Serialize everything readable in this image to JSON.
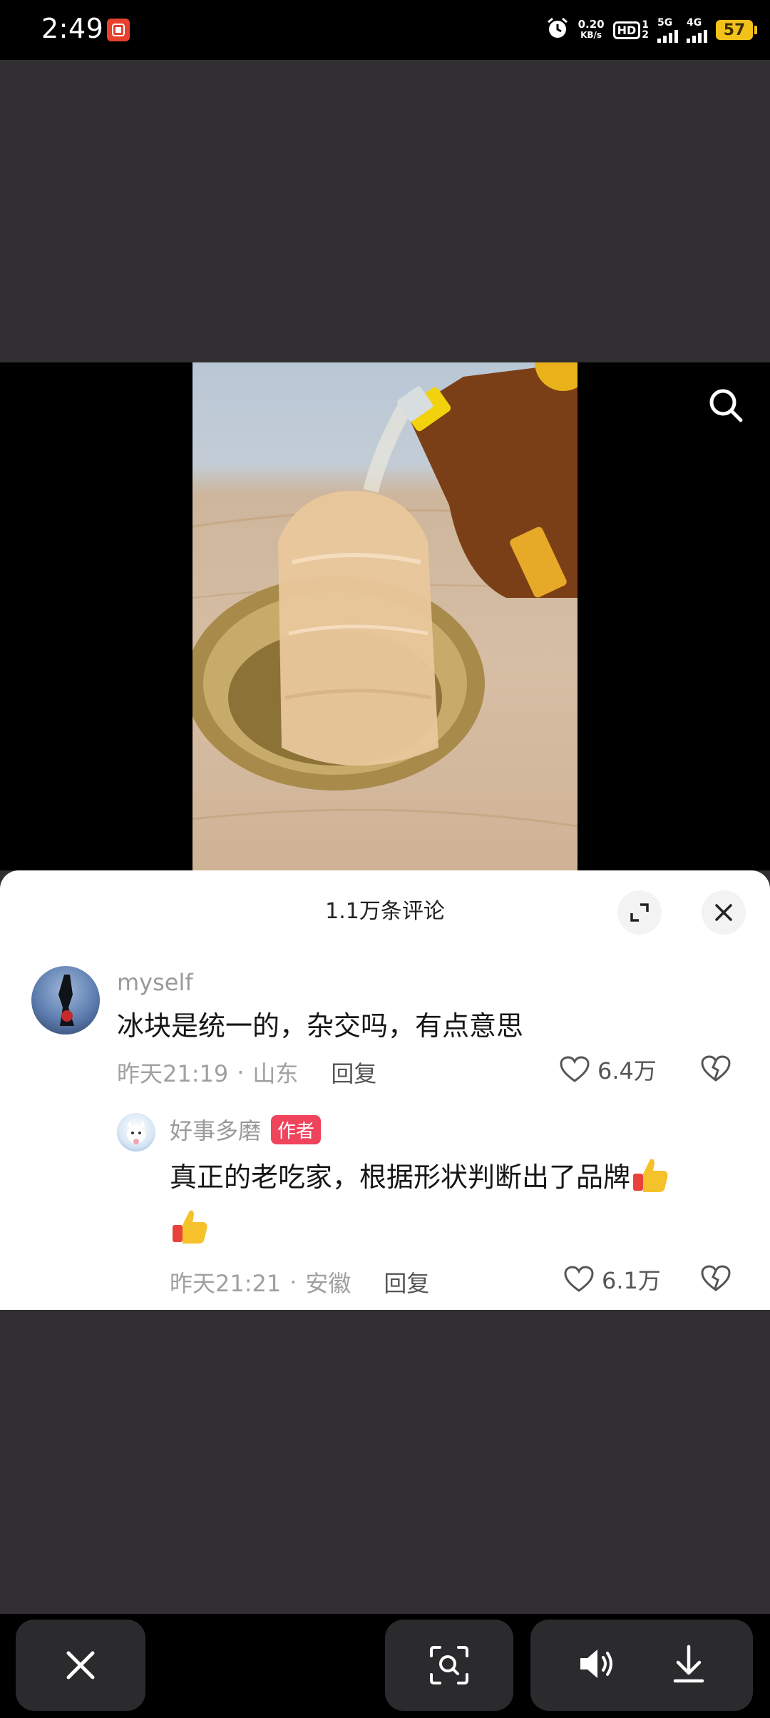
{
  "status_bar": {
    "time": "2:49",
    "net_speed_value": "0.20",
    "net_speed_unit": "KB/s",
    "hd_label": "HD",
    "sim1": "1",
    "sim2": "2",
    "net1": "5G",
    "net2": "4G",
    "battery": "57",
    "battery_color": "#f2c21b"
  },
  "video": {
    "search_icon": "search-icon"
  },
  "comments_panel": {
    "title": "1.1万条评论",
    "expand_icon": "expand-icon",
    "close_icon": "close-icon",
    "comments": [
      {
        "user": "myself",
        "text": "冰块是统一的，杂交吗，有点意思",
        "time": "昨天21:19",
        "separator": "·",
        "location": "山东",
        "reply_label": "回复",
        "likes": "6.4万"
      }
    ],
    "reply": {
      "user": "好事多磨",
      "badge": "作者",
      "badge_color": "#f0435c",
      "text": "真正的老吃家，根据形状判断出了品牌",
      "time": "昨天21:21",
      "separator": "·",
      "location": "安徽",
      "reply_label": "回复",
      "likes": "6.1万"
    }
  },
  "toolbar": {
    "close_icon": "close-icon",
    "lens_icon": "lens-scan-icon",
    "volume_icon": "volume-icon",
    "download_icon": "download-icon"
  }
}
